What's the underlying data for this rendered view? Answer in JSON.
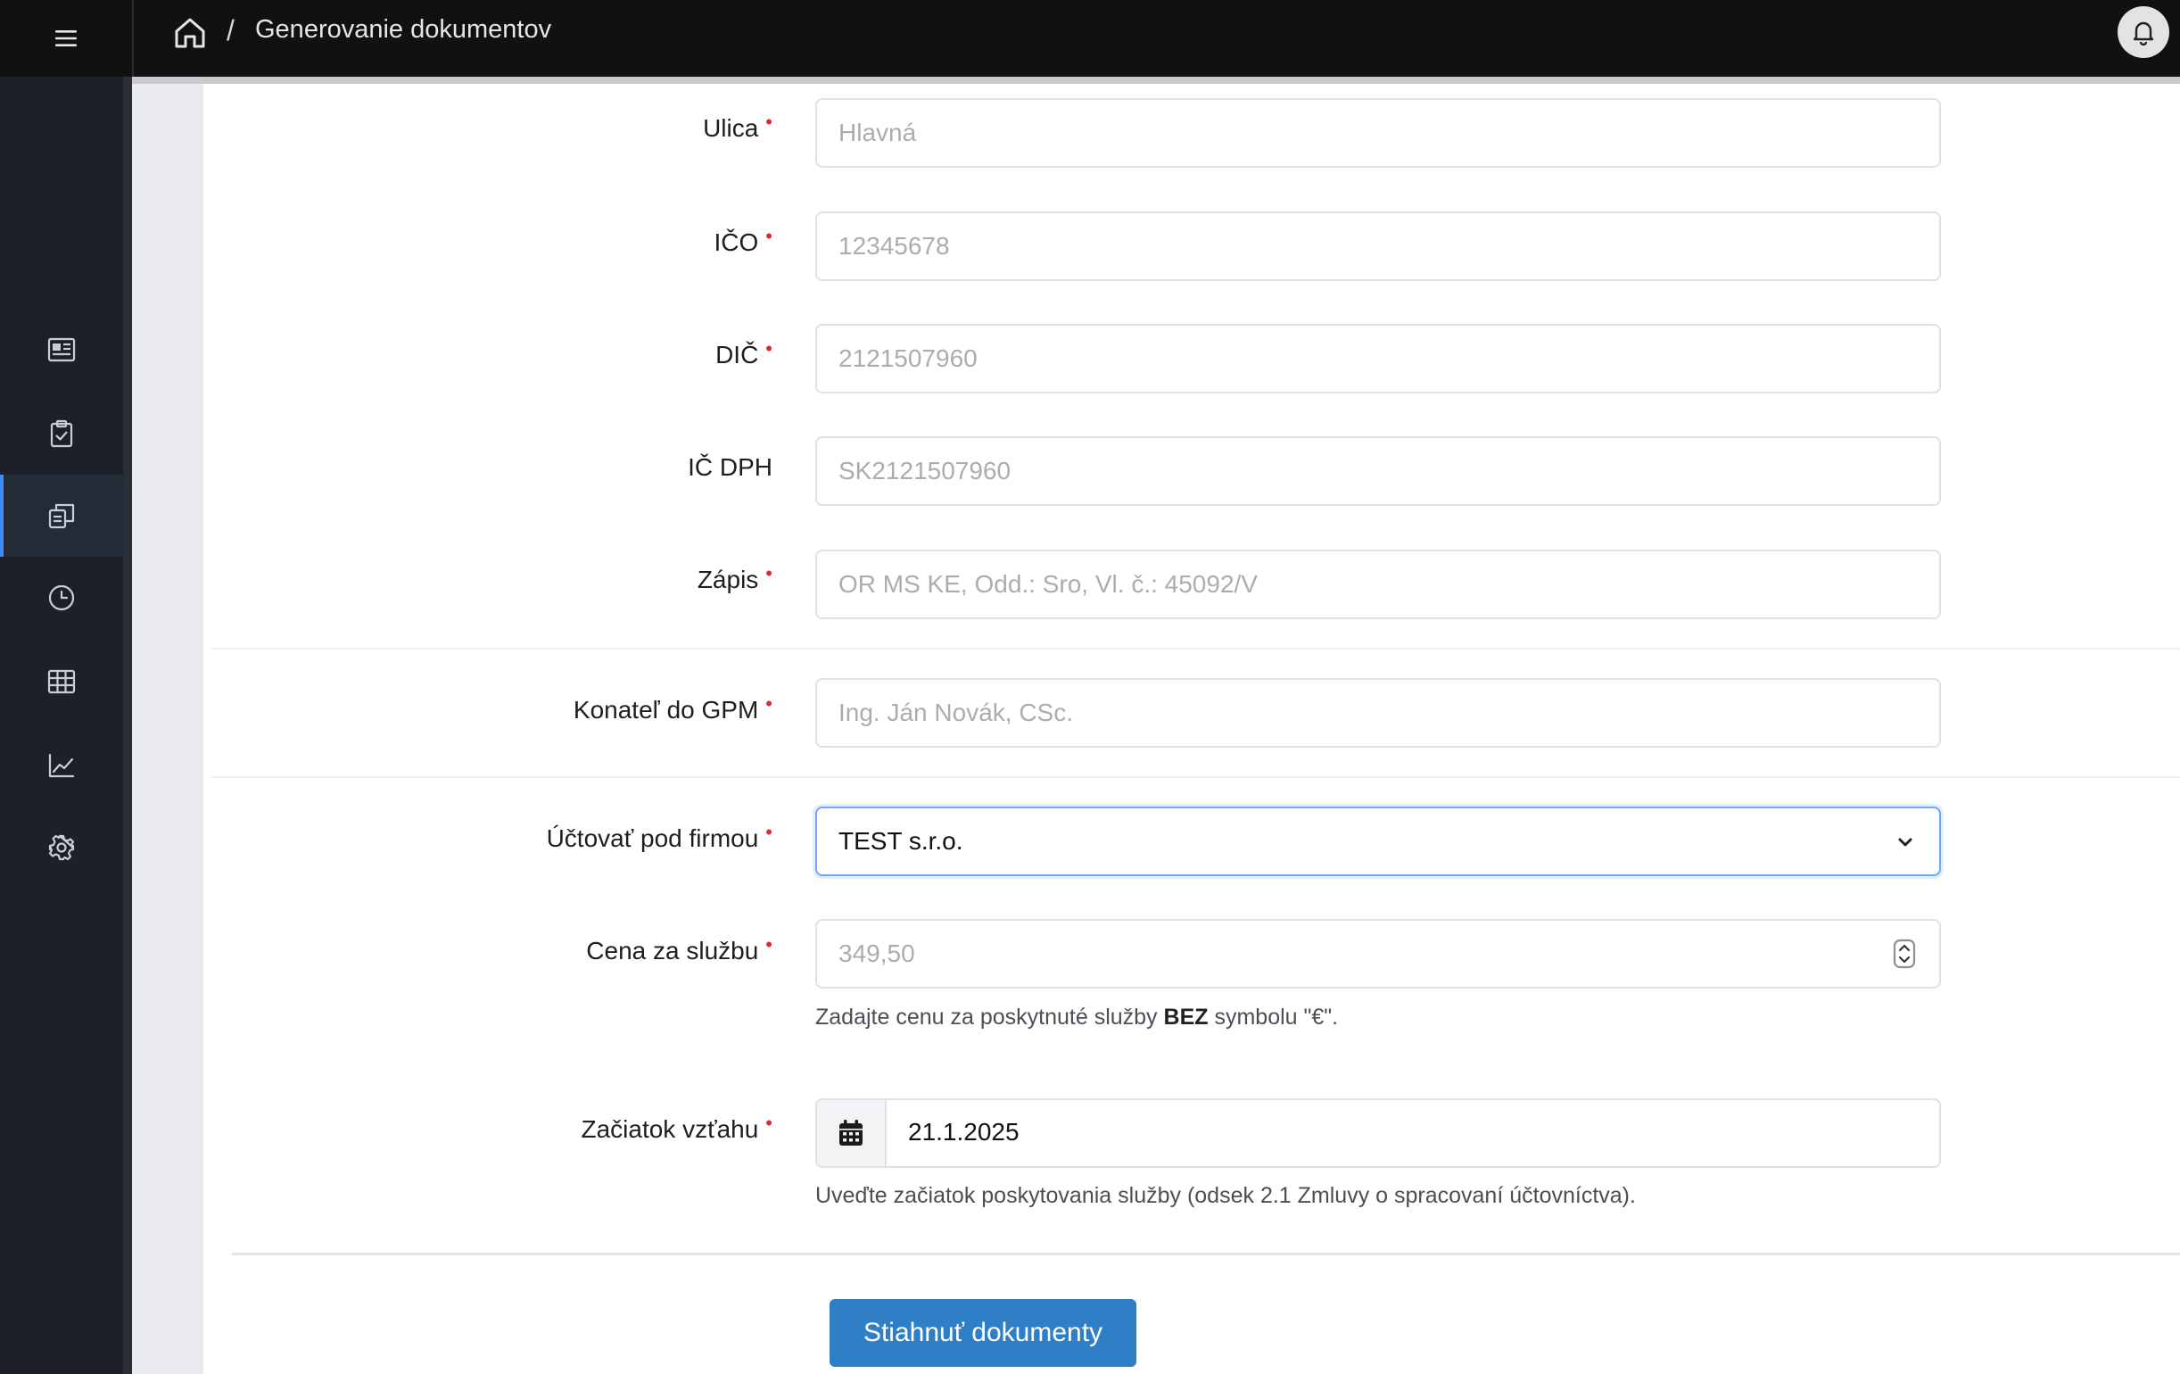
{
  "header": {
    "breadcrumb_separator": "/",
    "page_title": "Generovanie dokumentov",
    "icons": {
      "menu": "hamburger-icon",
      "home": "home-icon",
      "notifications": "bell-icon"
    }
  },
  "sidebar": {
    "items": [
      {
        "icon": "newspaper-icon",
        "active": false
      },
      {
        "icon": "clipboard-check-icon",
        "active": false
      },
      {
        "icon": "documents-icon",
        "active": true
      },
      {
        "icon": "clock-icon",
        "active": false
      },
      {
        "icon": "table-icon",
        "active": false
      },
      {
        "icon": "chart-line-icon",
        "active": false
      },
      {
        "icon": "gear-icon",
        "active": false
      }
    ],
    "accent_color": "#3d8bfd"
  },
  "form": {
    "required_marker": "•",
    "ulica": {
      "label": "Ulica",
      "placeholder": "Hlavná",
      "value": ""
    },
    "ico": {
      "label": "IČO",
      "placeholder": "12345678",
      "value": ""
    },
    "dic": {
      "label": "DIČ",
      "placeholder": "2121507960",
      "value": ""
    },
    "ic_dph": {
      "label": "IČ DPH",
      "placeholder": "SK2121507960",
      "value": ""
    },
    "zapis": {
      "label": "Zápis",
      "placeholder": "OR MS KE, Odd.: Sro, Vl. č.: 45092/V",
      "value": ""
    },
    "konatel": {
      "label": "Konateľ do GPM",
      "placeholder": "Ing. Ján Novák, CSc.",
      "value": ""
    },
    "uctovat": {
      "label": "Účtovať pod firmou",
      "selected": "TEST s.r.o."
    },
    "cena": {
      "label": "Cena za službu",
      "placeholder": "349,50",
      "value": "",
      "help_before": "Zadajte cenu za poskytnuté služby ",
      "help_bold": "BEZ",
      "help_after": " symbolu \"€\"."
    },
    "zaciatok": {
      "label": "Začiatok vzťahu",
      "value": "21.1.2025",
      "help": "Uveďte začiatok poskytovania služby (odsek 2.1 Zmluvy o spracovaní účtovníctva)."
    },
    "submit_label": "Stiahnuť dokumenty"
  },
  "colors": {
    "topbar": "#111111",
    "sidebar": "#1c2129",
    "required": "#d62d2d",
    "primary_button": "#2f7fc7",
    "focus_border": "#6ea8fe"
  }
}
